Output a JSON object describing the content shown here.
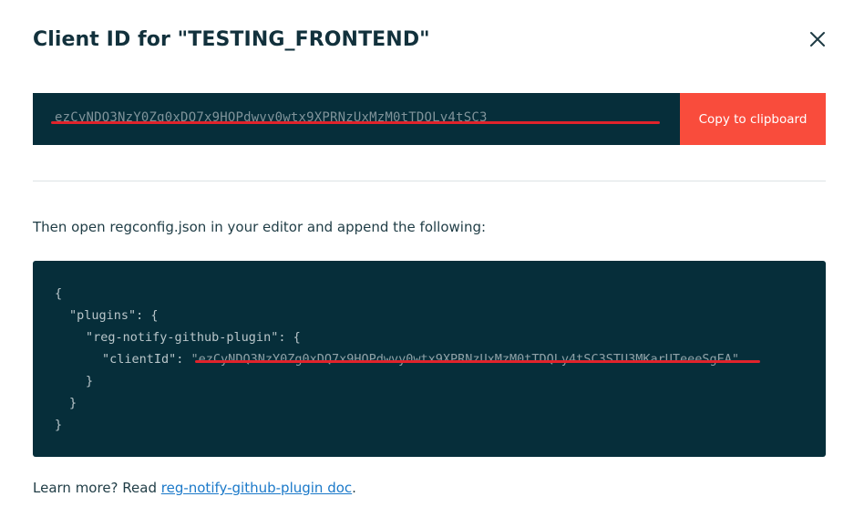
{
  "modal": {
    "title": "Client ID for \"TESTING_FRONTEND\"",
    "close_icon": "close-icon"
  },
  "token": {
    "value": "ezCyNDQ3NzY0Zg0xDQ7x9HOPdwvy0wtx9XPRNzUxMzM0tTDQLy4tSC3",
    "copy_label": "Copy to clipboard",
    "redaction_color": "#e0232b"
  },
  "instruction": {
    "text": "Then open regconfig.json in your editor and append the following:"
  },
  "code": {
    "line1": "{",
    "line2": "\"plugins\": {",
    "line3": "\"reg-notify-github-plugin\": {",
    "line4_key": "\"clientId\": ",
    "line4_value": "\"ezCyNDQ3NzY0Zg0xDQ7x9HOPdwvy0wtx9XPRNzUxMzM0tTDQLy4tSC3STU3MKarUTeeeSgEA\"",
    "line5": "}",
    "line6": "}",
    "line7": "}"
  },
  "footer": {
    "prefix": "Learn more? Read ",
    "link_text": "reg-notify-github-plugin doc",
    "suffix": "."
  },
  "colors": {
    "accent": "#f94c3c",
    "dark_panel": "#062e3a",
    "link": "#1b79c9"
  }
}
